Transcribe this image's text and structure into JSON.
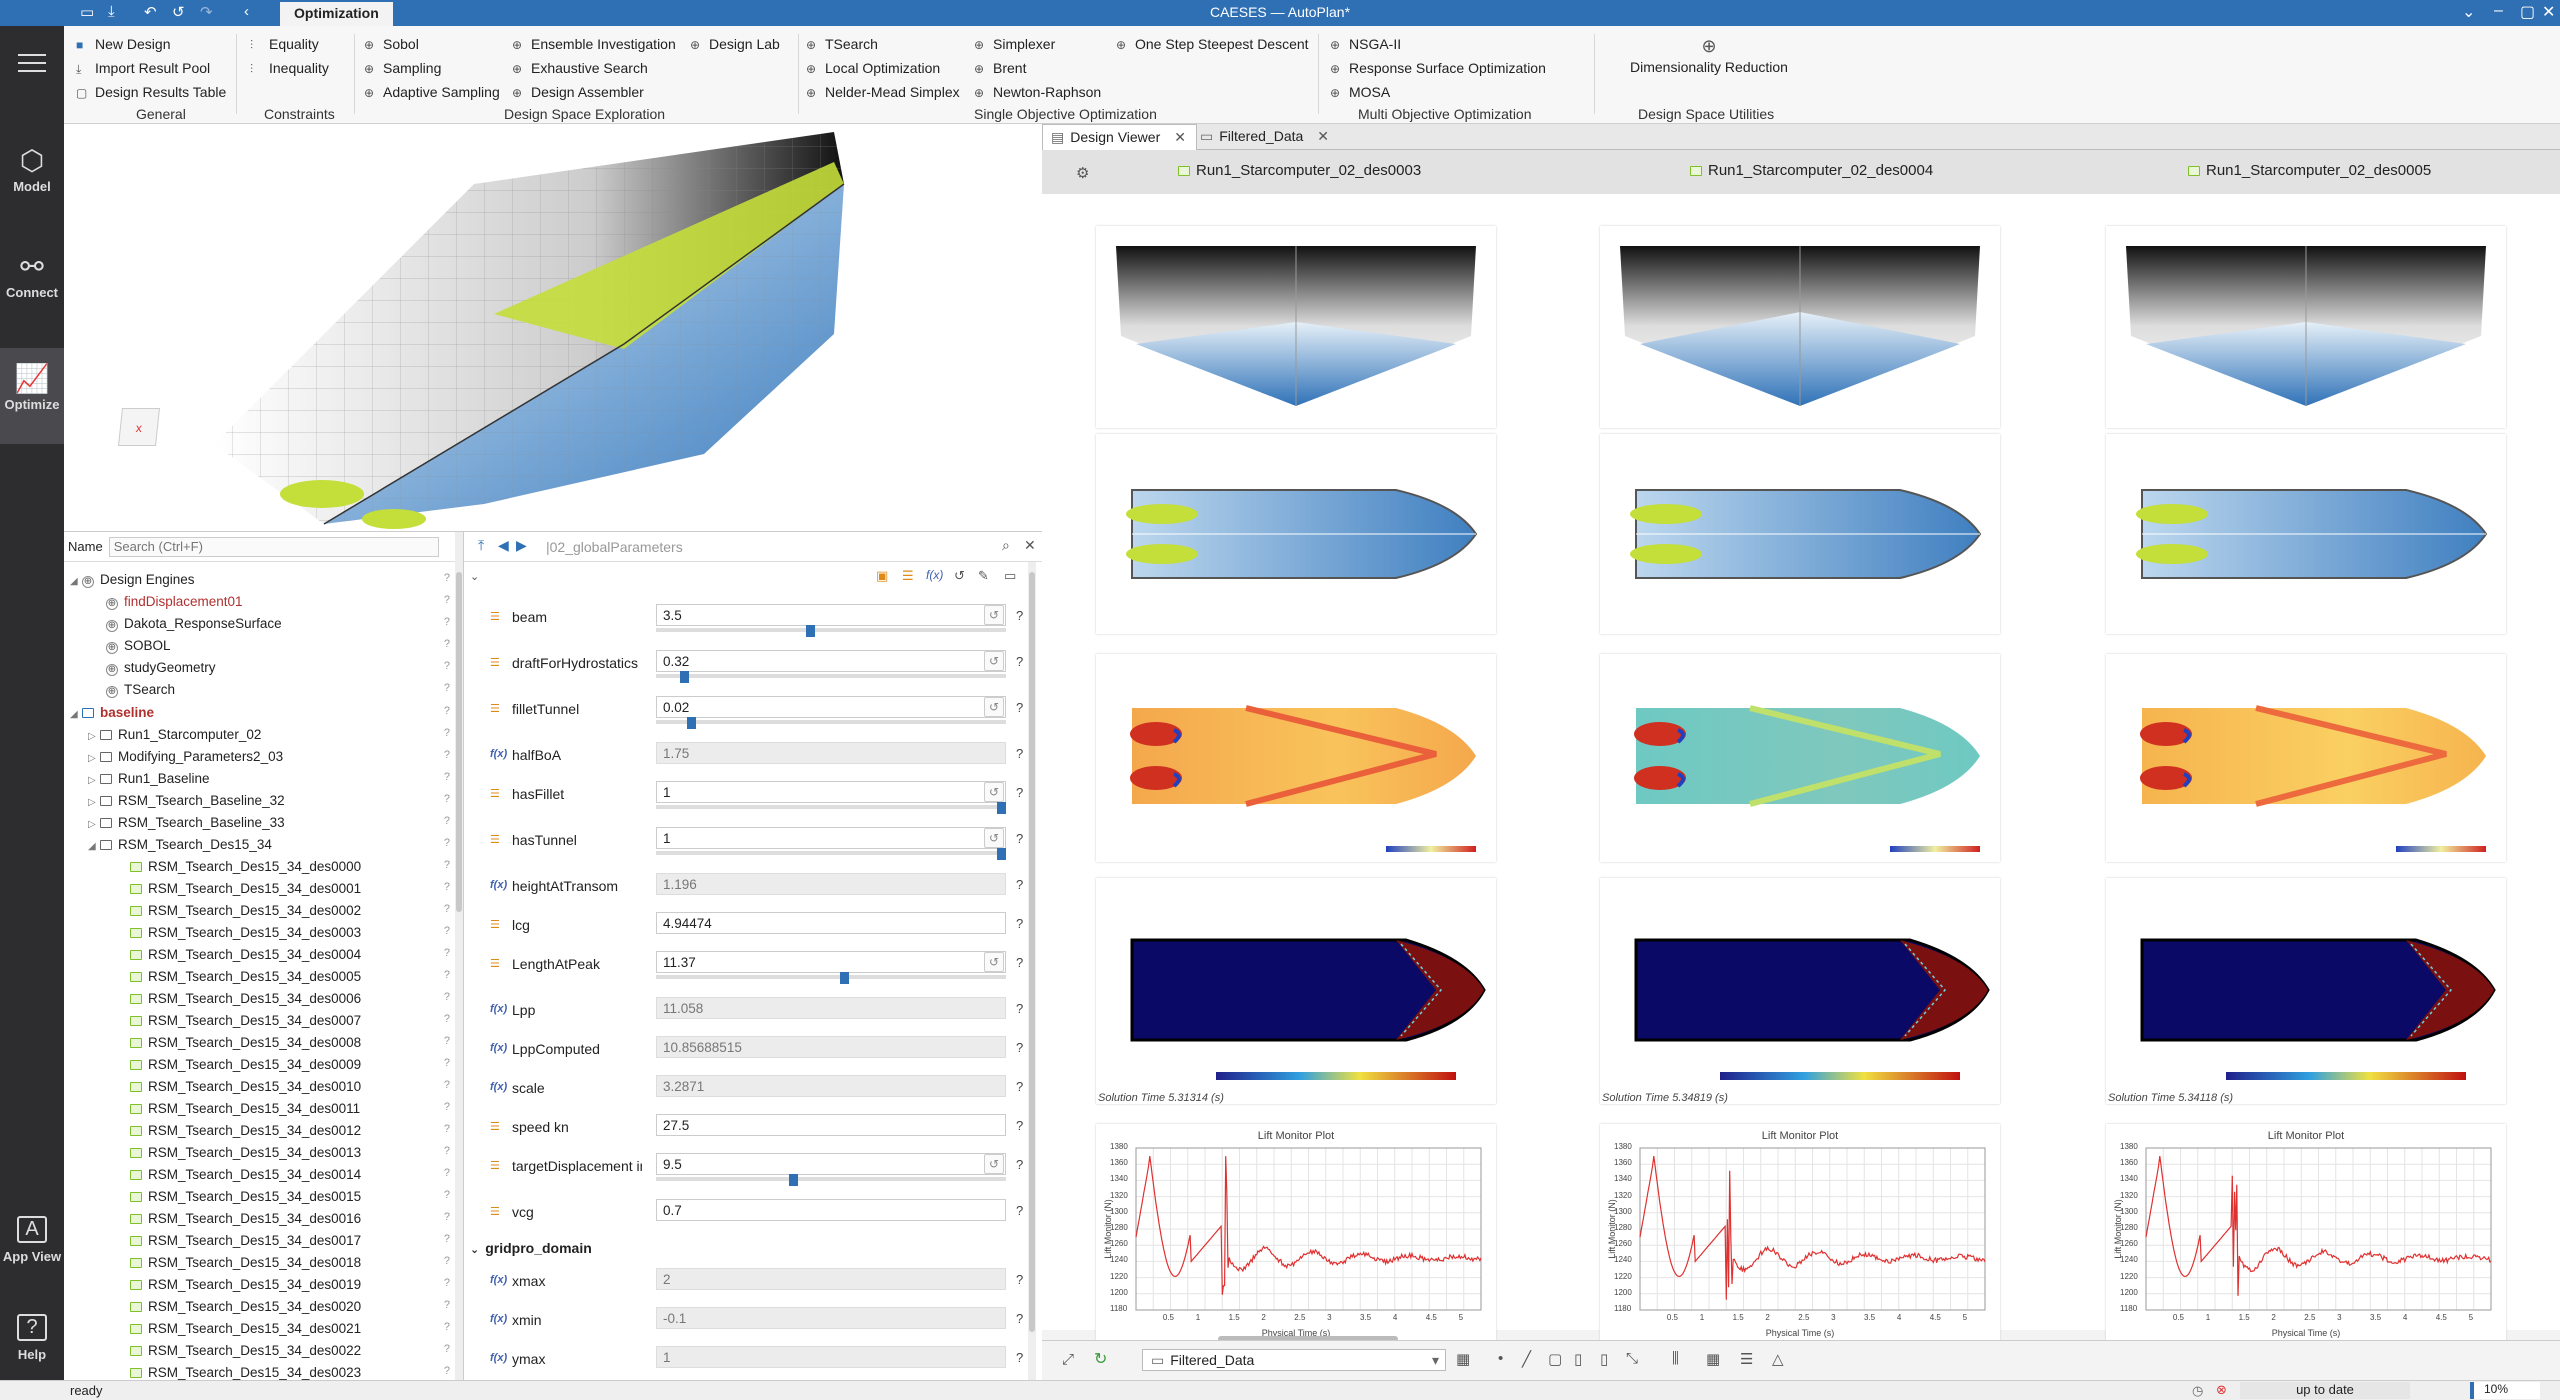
{
  "app": {
    "window_title": "CAESES — AutoPlan*",
    "active_tab": "Optimization"
  },
  "sidebar": {
    "items": [
      {
        "label": "Model",
        "icon": "cube-icon"
      },
      {
        "label": "Connect",
        "icon": "connect-icon"
      },
      {
        "label": "Optimize",
        "icon": "chart-icon",
        "active": true
      },
      {
        "label": "App View",
        "icon": "app-icon"
      },
      {
        "label": "Help",
        "icon": "help-icon"
      }
    ]
  },
  "ribbon": {
    "general": {
      "items": [
        "New Design",
        "Import Result Pool",
        "Design Results Table"
      ],
      "label": "General"
    },
    "constraints": {
      "items": [
        "Equality",
        "Inequality"
      ],
      "label": "Constraints"
    },
    "dse": {
      "items": [
        "Sobol",
        "Sampling",
        "Adaptive Sampling",
        "Ensemble Investigation",
        "Exhaustive Search",
        "Design Assembler",
        "Design Lab"
      ],
      "label": "Design Space Exploration"
    },
    "soo": {
      "items": [
        "TSearch",
        "Local Optimization",
        "Nelder-Mead Simplex",
        "Simplexer",
        "Brent",
        "Newton-Raphson",
        "One Step Steepest Descent"
      ],
      "label": "Single Objective Optimization"
    },
    "moo": {
      "items": [
        "NSGA-II",
        "Response Surface Optimization",
        "MOSA"
      ],
      "label": "Multi Objective Optimization"
    },
    "dsu": {
      "items": [
        "Dimensionality Reduction"
      ],
      "label": "Design Space Utilities"
    }
  },
  "tree": {
    "name_label": "Name",
    "search_placeholder": "Search (Ctrl+F)",
    "design_engines": {
      "label": "Design Engines",
      "items": [
        "findDisplacement01",
        "Dakota_ResponseSurface",
        "SOBOL",
        "studyGeometry",
        "TSearch"
      ]
    },
    "baseline": {
      "label": "baseline",
      "items": [
        "Run1_Starcomputer_02",
        "Modifying_Parameters2_03",
        "Run1_Baseline",
        "RSM_Tsearch_Baseline_32",
        "RSM_Tsearch_Baseline_33",
        "RSM_Tsearch_Des15_34"
      ]
    },
    "designs": [
      "RSM_Tsearch_Des15_34_des0000",
      "RSM_Tsearch_Des15_34_des0001",
      "RSM_Tsearch_Des15_34_des0002",
      "RSM_Tsearch_Des15_34_des0003",
      "RSM_Tsearch_Des15_34_des0004",
      "RSM_Tsearch_Des15_34_des0005",
      "RSM_Tsearch_Des15_34_des0006",
      "RSM_Tsearch_Des15_34_des0007",
      "RSM_Tsearch_Des15_34_des0008",
      "RSM_Tsearch_Des15_34_des0009",
      "RSM_Tsearch_Des15_34_des0010",
      "RSM_Tsearch_Des15_34_des0011",
      "RSM_Tsearch_Des15_34_des0012",
      "RSM_Tsearch_Des15_34_des0013",
      "RSM_Tsearch_Des15_34_des0014",
      "RSM_Tsearch_Des15_34_des0015",
      "RSM_Tsearch_Des15_34_des0016",
      "RSM_Tsearch_Des15_34_des0017",
      "RSM_Tsearch_Des15_34_des0018",
      "RSM_Tsearch_Des15_34_des0019",
      "RSM_Tsearch_Des15_34_des0020",
      "RSM_Tsearch_Des15_34_des0021",
      "RSM_Tsearch_Des15_34_des0022",
      "RSM_Tsearch_Des15_34_des0023"
    ]
  },
  "params": {
    "path": "|02_globalParameters",
    "rows": [
      {
        "name": "beam",
        "value": "3.5",
        "kind": "slider",
        "level": 0.44
      },
      {
        "name": "draftForHydrostatics",
        "value": "0.32",
        "kind": "slider",
        "level": 0.07
      },
      {
        "name": "filletTunnel",
        "value": "0.02",
        "kind": "slider",
        "level": 0.09
      },
      {
        "name": "halfBoA",
        "value": "1.75",
        "kind": "func"
      },
      {
        "name": "hasFillet",
        "value": "1",
        "kind": "slider",
        "level": 1.0
      },
      {
        "name": "hasTunnel",
        "value": "1",
        "kind": "slider",
        "level": 1.0
      },
      {
        "name": "heightAtTransom",
        "value": "1.196",
        "kind": "func"
      },
      {
        "name": "lcg",
        "value": "4.94474",
        "kind": "input"
      },
      {
        "name": "LengthAtPeak",
        "value": "11.37",
        "kind": "slider",
        "level": 0.54
      },
      {
        "name": "Lpp",
        "value": "11.058",
        "kind": "func"
      },
      {
        "name": "LppComputed",
        "value": "10.85688515",
        "kind": "func"
      },
      {
        "name": "scale",
        "value": "3.2871",
        "kind": "func"
      },
      {
        "name": "speed kn",
        "value": "27.5",
        "kind": "input"
      },
      {
        "name": "targetDisplacement inT",
        "value": "9.5",
        "kind": "slider",
        "level": 0.39
      },
      {
        "name": "vcg",
        "value": "0.7",
        "kind": "input"
      }
    ],
    "group": "gridpro_domain",
    "group_rows": [
      {
        "name": "xmax",
        "value": "2",
        "kind": "func"
      },
      {
        "name": "xmin",
        "value": "-0.1",
        "kind": "func"
      },
      {
        "name": "ymax",
        "value": "1",
        "kind": "func"
      }
    ]
  },
  "viewer": {
    "tabs": [
      "Design Viewer",
      "Filtered_Data"
    ],
    "columns": [
      {
        "title": "Run1_Starcomputer_02_des0003",
        "solution_time": "Solution Time 5.31314 (s)"
      },
      {
        "title": "Run1_Starcomputer_02_des0004",
        "solution_time": "Solution Time 5.34819 (s)"
      },
      {
        "title": "Run1_Starcomputer_02_des0005",
        "solution_time": "Solution Time 5.34118 (s)"
      }
    ],
    "plot_title": "Lift Monitor Plot",
    "plot_xlabel": "Physical Time (s)",
    "plot_ylabel": "Lift Monitor (N)",
    "plot_yticks": [
      "1380",
      "1360",
      "1340",
      "1320",
      "1300",
      "1280",
      "1260",
      "1240",
      "1220",
      "1200",
      "1180"
    ],
    "plot_xticks": [
      "0.5",
      "1",
      "1.5",
      "2",
      "2.5",
      "3",
      "3.5",
      "4",
      "4.5",
      "5"
    ],
    "filter_select": "Filtered_Data",
    "colors": {
      "accent": "#2f6fb3",
      "hull_blue": "#5b9bd5",
      "hull_green": "#c4de3a",
      "plot_line": "#e03030"
    }
  },
  "status": {
    "left": "ready",
    "sync": "up to date",
    "zoom": "10%"
  }
}
